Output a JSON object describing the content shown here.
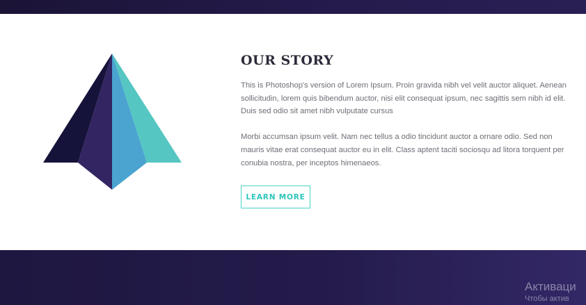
{
  "story": {
    "title": "OUR STORY",
    "paragraph_1": "This is Photoshop's version  of Lorem Ipsum. Proin gravida nibh vel velit auctor aliquet. Aenean sollicitudin, lorem quis bibendum auctor, nisi elit consequat ipsum, nec sagittis sem nibh id elit. Duis sed odio sit amet nibh vulputate cursus",
    "paragraph_2": "Morbi accumsan ipsum velit. Nam nec tellus a odio tincidunt auctor a ornare odio. Sed non  mauris vitae erat consequat auctor eu in elit. Class aptent taciti sociosqu ad litora torquent per conubia nostra, per inceptos himenaeos.",
    "button_label": "LEARN MORE"
  },
  "logo": {
    "icon": "pyramid-logo-icon",
    "colors": {
      "dark": "#16133a",
      "purple": "#332462",
      "blue": "#4aa4cf",
      "teal": "#55c6c2"
    }
  },
  "accent_color": "#2ec6ba",
  "overlay": {
    "title": "Активаци",
    "subtitle": "Чтобы актив"
  }
}
